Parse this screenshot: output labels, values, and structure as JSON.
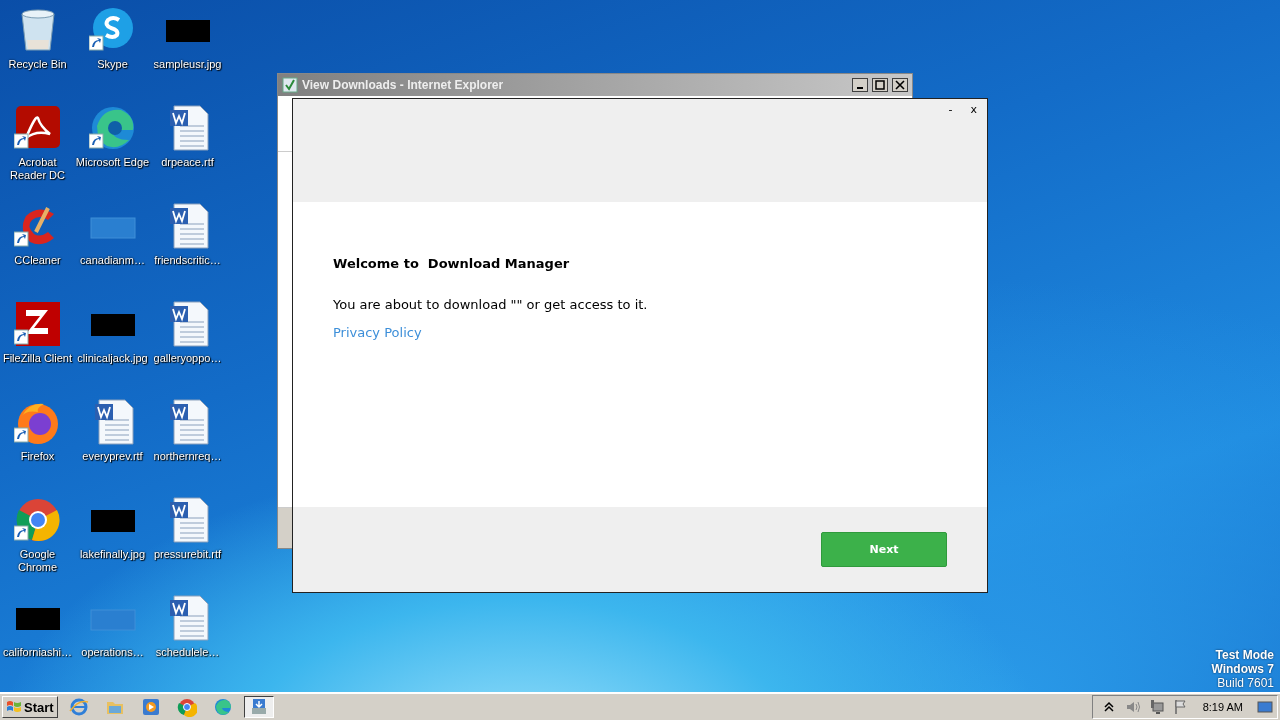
{
  "desktop_icons": [
    {
      "label": "Recycle Bin",
      "kind": "recycle",
      "shortcut": false
    },
    {
      "label": "Acrobat Reader DC",
      "kind": "pdf",
      "shortcut": true
    },
    {
      "label": "CCleaner",
      "kind": "ccleaner",
      "shortcut": true
    },
    {
      "label": "FileZilla Client",
      "kind": "filezilla",
      "shortcut": true
    },
    {
      "label": "Firefox",
      "kind": "firefox",
      "shortcut": true
    },
    {
      "label": "Google Chrome",
      "kind": "chrome",
      "shortcut": true
    },
    {
      "label": "californiashi…",
      "kind": "image",
      "shortcut": false
    },
    {
      "label": "Skype",
      "kind": "skype",
      "shortcut": true
    },
    {
      "label": "Microsoft Edge",
      "kind": "edge",
      "shortcut": true
    },
    {
      "label": "canadianm…",
      "kind": "blank",
      "shortcut": false
    },
    {
      "label": "clinicaljack.jpg",
      "kind": "image",
      "shortcut": false
    },
    {
      "label": "everyprev.rtf",
      "kind": "doc",
      "shortcut": false
    },
    {
      "label": "lakefinally.jpg",
      "kind": "image",
      "shortcut": false
    },
    {
      "label": "operations…",
      "kind": "blank",
      "shortcut": false
    },
    {
      "label": "sampleusr.jpg",
      "kind": "image",
      "shortcut": false
    },
    {
      "label": "drpeace.rtf",
      "kind": "doc",
      "shortcut": false
    },
    {
      "label": "friendscritic…",
      "kind": "doc",
      "shortcut": false
    },
    {
      "label": "galleryoppo…",
      "kind": "doc",
      "shortcut": false
    },
    {
      "label": "northernreq…",
      "kind": "doc",
      "shortcut": false
    },
    {
      "label": "pressurebit.rtf",
      "kind": "doc",
      "shortcut": false
    },
    {
      "label": "schedulele…",
      "kind": "doc",
      "shortcut": false
    }
  ],
  "ie_window": {
    "title": "View Downloads - Internet Explorer"
  },
  "dialog": {
    "minimize": "-",
    "close": "x",
    "heading": "Welcome to  Download Manager",
    "text": "You are about to download \"\" or get access to it.",
    "link": "Privacy Policy",
    "button": "Next"
  },
  "system_text": [
    "Test Mode",
    "Windows 7",
    "Build 7601"
  ],
  "taskbar": {
    "start": "Start",
    "apps": [
      {
        "kind": "ie",
        "selected": false
      },
      {
        "kind": "folder",
        "selected": false
      },
      {
        "kind": "media",
        "selected": false
      },
      {
        "kind": "chrome",
        "selected": false
      },
      {
        "kind": "edge",
        "selected": false
      },
      {
        "kind": "installer",
        "selected": true
      }
    ],
    "time": "8:19 AM"
  }
}
